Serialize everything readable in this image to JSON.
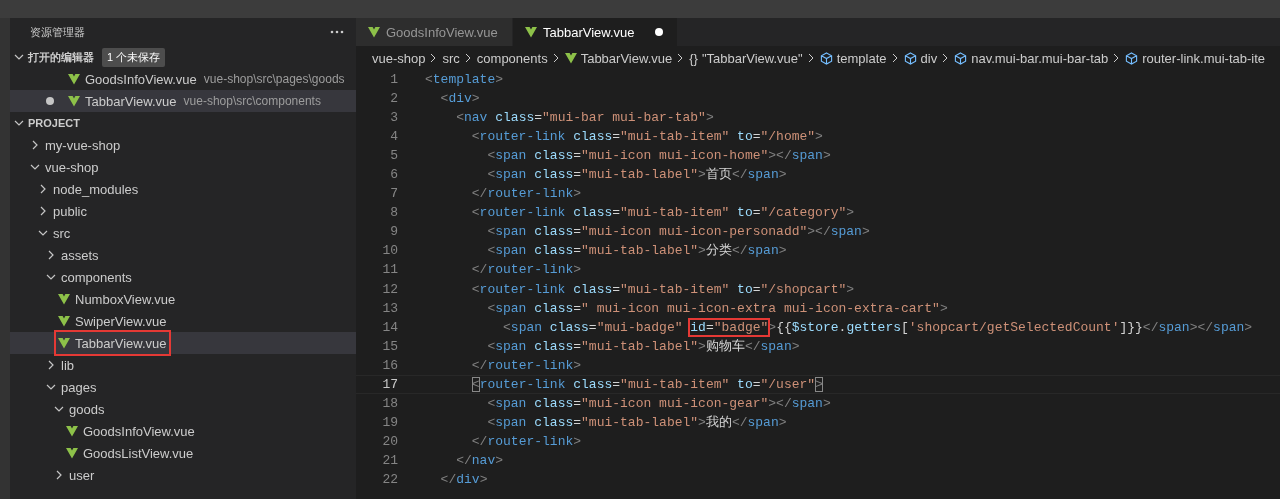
{
  "sidebar": {
    "title": "资源管理器",
    "open_editors": {
      "title": "打开的编辑器",
      "expanded": true,
      "badge": "1 个未保存",
      "items": [
        {
          "name": "GoodsInfoView.vue",
          "path": "vue-shop\\src\\pages\\goods",
          "modified": false,
          "selected": false
        },
        {
          "name": "TabbarView.vue",
          "path": "vue-shop\\src\\components",
          "modified": true,
          "selected": true
        }
      ]
    },
    "project": {
      "title": "PROJECT",
      "expanded": true,
      "items": [
        {
          "kind": "folder",
          "name": "my-vue-shop",
          "expanded": false,
          "selected": false,
          "highlighted": false
        },
        {
          "kind": "folder",
          "name": "vue-shop",
          "expanded": true,
          "selected": false,
          "highlighted": false,
          "children": [
            {
              "kind": "folder",
              "name": "node_modules",
              "expanded": false,
              "selected": false,
              "highlighted": false
            },
            {
              "kind": "folder",
              "name": "public",
              "expanded": false,
              "selected": false,
              "highlighted": false
            },
            {
              "kind": "folder",
              "name": "src",
              "expanded": true,
              "selected": false,
              "highlighted": false,
              "children": [
                {
                  "kind": "folder",
                  "name": "assets",
                  "expanded": false,
                  "selected": false,
                  "highlighted": false
                },
                {
                  "kind": "folder",
                  "name": "components",
                  "expanded": true,
                  "selected": false,
                  "highlighted": false,
                  "children": [
                    {
                      "kind": "file",
                      "name": "NumboxView.vue",
                      "selected": false,
                      "highlighted": false
                    },
                    {
                      "kind": "file",
                      "name": "SwiperView.vue",
                      "selected": false,
                      "highlighted": false
                    },
                    {
                      "kind": "file",
                      "name": "TabbarView.vue",
                      "selected": true,
                      "highlighted": true
                    }
                  ]
                },
                {
                  "kind": "folder",
                  "name": "lib",
                  "expanded": false,
                  "selected": false,
                  "highlighted": false
                },
                {
                  "kind": "folder",
                  "name": "pages",
                  "expanded": true,
                  "selected": false,
                  "highlighted": false,
                  "children": [
                    {
                      "kind": "folder",
                      "name": "goods",
                      "expanded": true,
                      "selected": false,
                      "highlighted": false,
                      "children": [
                        {
                          "kind": "file",
                          "name": "GoodsInfoView.vue",
                          "selected": false,
                          "highlighted": false
                        },
                        {
                          "kind": "file",
                          "name": "GoodsListView.vue",
                          "selected": false,
                          "highlighted": false
                        }
                      ]
                    },
                    {
                      "kind": "folder",
                      "name": "user",
                      "expanded": false,
                      "selected": false,
                      "highlighted": false
                    }
                  ]
                }
              ]
            }
          ]
        }
      ]
    }
  },
  "tabs": [
    {
      "label": "GoodsInfoView.vue",
      "selected": false,
      "modified": false
    },
    {
      "label": "TabbarView.vue",
      "selected": true,
      "modified": true
    }
  ],
  "breadcrumb": [
    {
      "kind": "text",
      "label": "vue-shop"
    },
    {
      "kind": "text",
      "label": "src"
    },
    {
      "kind": "text",
      "label": "components"
    },
    {
      "kind": "vue",
      "label": "TabbarView.vue"
    },
    {
      "kind": "braces",
      "icon": "{}",
      "label": "\"TabbarView.vue\""
    },
    {
      "kind": "element",
      "label": "template"
    },
    {
      "kind": "element",
      "label": "div"
    },
    {
      "kind": "element",
      "label": "nav.mui-bar.mui-bar-tab"
    },
    {
      "kind": "element",
      "label": "router-link.mui-tab-ite"
    }
  ],
  "code": [
    {
      "number": "1",
      "current": false,
      "tokens": [
        {
          "kind": "p",
          "text": "<"
        },
        {
          "kind": "tag",
          "text": "template"
        },
        {
          "kind": "p",
          "text": ">"
        }
      ]
    },
    {
      "number": "2",
      "current": false,
      "tokens": [
        {
          "kind": "p",
          "text": "  <"
        },
        {
          "kind": "tag",
          "text": "div"
        },
        {
          "kind": "p",
          "text": ">"
        }
      ]
    },
    {
      "number": "3",
      "current": false,
      "tokens": [
        {
          "kind": "p",
          "text": "    <"
        },
        {
          "kind": "tag",
          "text": "nav"
        },
        {
          "kind": "attr",
          "text": " class"
        },
        {
          "kind": "text",
          "text": "="
        },
        {
          "kind": "str",
          "text": "\"mui-bar mui-bar-tab\""
        },
        {
          "kind": "p",
          "text": ">"
        }
      ]
    },
    {
      "number": "4",
      "current": false,
      "tokens": [
        {
          "kind": "p",
          "text": "      <"
        },
        {
          "kind": "tag",
          "text": "router-link"
        },
        {
          "kind": "attr",
          "text": " class"
        },
        {
          "kind": "text",
          "text": "="
        },
        {
          "kind": "str",
          "text": "\"mui-tab-item\""
        },
        {
          "kind": "attr",
          "text": " to"
        },
        {
          "kind": "text",
          "text": "="
        },
        {
          "kind": "str",
          "text": "\"/home\""
        },
        {
          "kind": "p",
          "text": ">"
        }
      ]
    },
    {
      "number": "5",
      "current": false,
      "tokens": [
        {
          "kind": "p",
          "text": "        <"
        },
        {
          "kind": "tag",
          "text": "span"
        },
        {
          "kind": "attr",
          "text": " class"
        },
        {
          "kind": "text",
          "text": "="
        },
        {
          "kind": "str",
          "text": "\"mui-icon mui-icon-home\""
        },
        {
          "kind": "p",
          "text": "></"
        },
        {
          "kind": "tag",
          "text": "span"
        },
        {
          "kind": "p",
          "text": ">"
        }
      ]
    },
    {
      "number": "6",
      "current": false,
      "tokens": [
        {
          "kind": "p",
          "text": "        <"
        },
        {
          "kind": "tag",
          "text": "span"
        },
        {
          "kind": "attr",
          "text": " class"
        },
        {
          "kind": "text",
          "text": "="
        },
        {
          "kind": "str",
          "text": "\"mui-tab-label\""
        },
        {
          "kind": "p",
          "text": ">"
        },
        {
          "kind": "text",
          "text": "首页"
        },
        {
          "kind": "p",
          "text": "</"
        },
        {
          "kind": "tag",
          "text": "span"
        },
        {
          "kind": "p",
          "text": ">"
        }
      ]
    },
    {
      "number": "7",
      "current": false,
      "tokens": [
        {
          "kind": "p",
          "text": "      </"
        },
        {
          "kind": "tag",
          "text": "router-link"
        },
        {
          "kind": "p",
          "text": ">"
        }
      ]
    },
    {
      "number": "8",
      "current": false,
      "tokens": [
        {
          "kind": "p",
          "text": "      <"
        },
        {
          "kind": "tag",
          "text": "router-link"
        },
        {
          "kind": "attr",
          "text": " class"
        },
        {
          "kind": "text",
          "text": "="
        },
        {
          "kind": "str",
          "text": "\"mui-tab-item\""
        },
        {
          "kind": "attr",
          "text": " to"
        },
        {
          "kind": "text",
          "text": "="
        },
        {
          "kind": "str",
          "text": "\"/category\""
        },
        {
          "kind": "p",
          "text": ">"
        }
      ]
    },
    {
      "number": "9",
      "current": false,
      "tokens": [
        {
          "kind": "p",
          "text": "        <"
        },
        {
          "kind": "tag",
          "text": "span"
        },
        {
          "kind": "attr",
          "text": " class"
        },
        {
          "kind": "text",
          "text": "="
        },
        {
          "kind": "str",
          "text": "\"mui-icon mui-icon-personadd\""
        },
        {
          "kind": "p",
          "text": "></"
        },
        {
          "kind": "tag",
          "text": "span"
        },
        {
          "kind": "p",
          "text": ">"
        }
      ]
    },
    {
      "number": "10",
      "current": false,
      "tokens": [
        {
          "kind": "p",
          "text": "        <"
        },
        {
          "kind": "tag",
          "text": "span"
        },
        {
          "kind": "attr",
          "text": " class"
        },
        {
          "kind": "text",
          "text": "="
        },
        {
          "kind": "str",
          "text": "\"mui-tab-label\""
        },
        {
          "kind": "p",
          "text": ">"
        },
        {
          "kind": "text",
          "text": "分类"
        },
        {
          "kind": "p",
          "text": "</"
        },
        {
          "kind": "tag",
          "text": "span"
        },
        {
          "kind": "p",
          "text": ">"
        }
      ]
    },
    {
      "number": "11",
      "current": false,
      "tokens": [
        {
          "kind": "p",
          "text": "      </"
        },
        {
          "kind": "tag",
          "text": "router-link"
        },
        {
          "kind": "p",
          "text": ">"
        }
      ]
    },
    {
      "number": "12",
      "current": false,
      "tokens": [
        {
          "kind": "p",
          "text": "      <"
        },
        {
          "kind": "tag",
          "text": "router-link"
        },
        {
          "kind": "attr",
          "text": " class"
        },
        {
          "kind": "text",
          "text": "="
        },
        {
          "kind": "str",
          "text": "\"mui-tab-item\""
        },
        {
          "kind": "attr",
          "text": " to"
        },
        {
          "kind": "text",
          "text": "="
        },
        {
          "kind": "str",
          "text": "\"/shopcart\""
        },
        {
          "kind": "p",
          "text": ">"
        }
      ]
    },
    {
      "number": "13",
      "current": false,
      "tokens": [
        {
          "kind": "p",
          "text": "        <"
        },
        {
          "kind": "tag",
          "text": "span"
        },
        {
          "kind": "attr",
          "text": " class"
        },
        {
          "kind": "text",
          "text": "="
        },
        {
          "kind": "str",
          "text": "\" mui-icon mui-icon-extra mui-icon-extra-cart\""
        },
        {
          "kind": "p",
          "text": ">"
        }
      ]
    },
    {
      "number": "14",
      "current": false,
      "tokens": [
        {
          "kind": "p",
          "text": "          <"
        },
        {
          "kind": "tag",
          "text": "span"
        },
        {
          "kind": "attr",
          "text": " class"
        },
        {
          "kind": "text",
          "text": "="
        },
        {
          "kind": "str",
          "text": "\"mui-badge\""
        },
        {
          "kind": "red-frame",
          "tokens": [
            {
              "kind": "attr",
              "text": " id"
            },
            {
              "kind": "text",
              "text": "="
            },
            {
              "kind": "str",
              "text": "\"badge\""
            }
          ]
        },
        {
          "kind": "p",
          "text": ">"
        },
        {
          "kind": "text",
          "text": "{{"
        },
        {
          "kind": "var",
          "text": "$store"
        },
        {
          "kind": "text",
          "text": "."
        },
        {
          "kind": "var",
          "text": "getters"
        },
        {
          "kind": "text",
          "text": "["
        },
        {
          "kind": "str",
          "text": "'shopcart/getSelectedCount'"
        },
        {
          "kind": "text",
          "text": "]}}"
        },
        {
          "kind": "p",
          "text": "</"
        },
        {
          "kind": "tag",
          "text": "span"
        },
        {
          "kind": "p",
          "text": "></"
        },
        {
          "kind": "tag",
          "text": "span"
        },
        {
          "kind": "p",
          "text": ">"
        }
      ]
    },
    {
      "number": "15",
      "current": false,
      "tokens": [
        {
          "kind": "p",
          "text": "        <"
        },
        {
          "kind": "tag",
          "text": "span"
        },
        {
          "kind": "attr",
          "text": " class"
        },
        {
          "kind": "text",
          "text": "="
        },
        {
          "kind": "str",
          "text": "\"mui-tab-label\""
        },
        {
          "kind": "p",
          "text": ">"
        },
        {
          "kind": "text",
          "text": "购物车"
        },
        {
          "kind": "p",
          "text": "</"
        },
        {
          "kind": "tag",
          "text": "span"
        },
        {
          "kind": "p",
          "text": ">"
        }
      ]
    },
    {
      "number": "16",
      "current": false,
      "tokens": [
        {
          "kind": "p",
          "text": "      </"
        },
        {
          "kind": "tag",
          "text": "router-link"
        },
        {
          "kind": "p",
          "text": ">"
        }
      ]
    },
    {
      "number": "17",
      "current": true,
      "tokens": [
        {
          "kind": "bracket-match",
          "tokens": [
            {
              "kind": "p",
              "text": "      <"
            }
          ]
        },
        {
          "kind": "tag",
          "text": "router-link"
        },
        {
          "kind": "attr",
          "text": " class"
        },
        {
          "kind": "text",
          "text": "="
        },
        {
          "kind": "str",
          "text": "\"mui-tab-item\""
        },
        {
          "kind": "attr",
          "text": " to"
        },
        {
          "kind": "text",
          "text": "="
        },
        {
          "kind": "str",
          "text": "\"/user\""
        },
        {
          "kind": "bracket-match",
          "tokens": [
            {
              "kind": "p",
              "text": ">"
            }
          ]
        }
      ]
    },
    {
      "number": "18",
      "current": false,
      "tokens": [
        {
          "kind": "p",
          "text": "        <"
        },
        {
          "kind": "tag",
          "text": "span"
        },
        {
          "kind": "attr",
          "text": " class"
        },
        {
          "kind": "text",
          "text": "="
        },
        {
          "kind": "str",
          "text": "\"mui-icon mui-icon-gear\""
        },
        {
          "kind": "p",
          "text": "></"
        },
        {
          "kind": "tag",
          "text": "span"
        },
        {
          "kind": "p",
          "text": ">"
        }
      ]
    },
    {
      "number": "19",
      "current": false,
      "tokens": [
        {
          "kind": "p",
          "text": "        <"
        },
        {
          "kind": "tag",
          "text": "span"
        },
        {
          "kind": "attr",
          "text": " class"
        },
        {
          "kind": "text",
          "text": "="
        },
        {
          "kind": "str",
          "text": "\"mui-tab-label\""
        },
        {
          "kind": "p",
          "text": ">"
        },
        {
          "kind": "text",
          "text": "我的"
        },
        {
          "kind": "p",
          "text": "</"
        },
        {
          "kind": "tag",
          "text": "span"
        },
        {
          "kind": "p",
          "text": ">"
        }
      ]
    },
    {
      "number": "20",
      "current": false,
      "tokens": [
        {
          "kind": "p",
          "text": "      </"
        },
        {
          "kind": "tag",
          "text": "router-link"
        },
        {
          "kind": "p",
          "text": ">"
        }
      ]
    },
    {
      "number": "21",
      "current": false,
      "tokens": [
        {
          "kind": "p",
          "text": "    </"
        },
        {
          "kind": "tag",
          "text": "nav"
        },
        {
          "kind": "p",
          "text": ">"
        }
      ]
    },
    {
      "number": "22",
      "current": false,
      "tokens": [
        {
          "kind": "p",
          "text": "  </"
        },
        {
          "kind": "tag",
          "text": "div"
        },
        {
          "kind": "p",
          "text": ">"
        }
      ]
    }
  ]
}
